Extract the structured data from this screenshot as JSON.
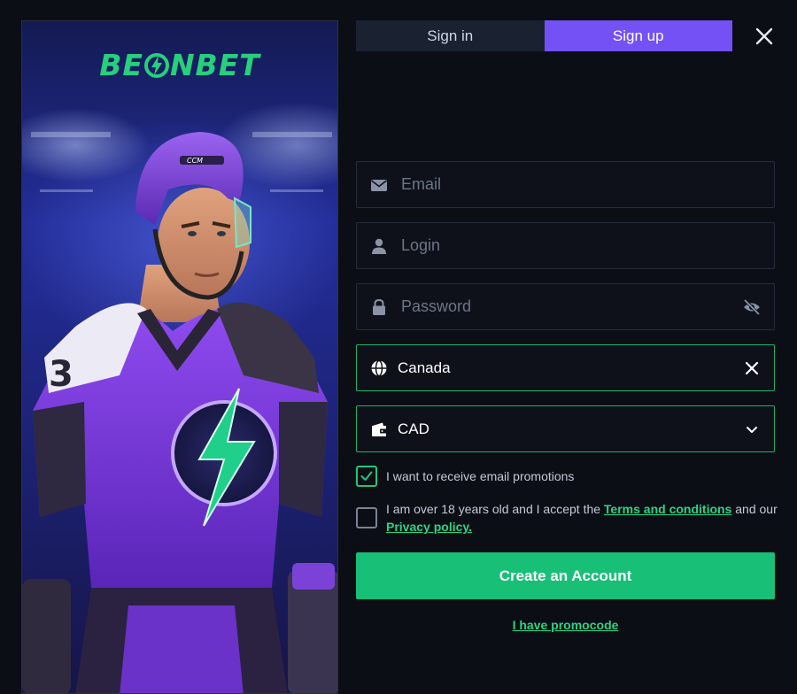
{
  "brand": {
    "logo_text": "BEONBET",
    "logo_before": "BE",
    "logo_after": "NBET"
  },
  "tabs": {
    "sign_in": "Sign in",
    "sign_up": "Sign up",
    "active": "sign_up"
  },
  "form": {
    "email": {
      "placeholder": "Email",
      "icon": "envelope-icon"
    },
    "login": {
      "placeholder": "Login",
      "icon": "user-icon"
    },
    "password": {
      "placeholder": "Password",
      "icon": "lock-icon",
      "toggle_icon": "eye-off-icon"
    },
    "country": {
      "value": "Canada",
      "icon": "globe-icon",
      "clear_icon": "close-icon"
    },
    "currency": {
      "value": "CAD",
      "icon": "wallet-icon",
      "dropdown_icon": "chevron-down-icon"
    }
  },
  "consents": {
    "email_promotions": {
      "label": "I want to receive email promotions",
      "checked": true
    },
    "terms": {
      "text_before": "I am over 18 years old and I accept the",
      "terms_link": "Terms and conditions",
      "text_middle": "and our",
      "privacy_link": "Privacy policy.",
      "checked": false
    }
  },
  "actions": {
    "create_account": "Create an Account",
    "promocode": "I have promocode"
  },
  "colors": {
    "accent_green": "#17bf77",
    "accent_purple": "#7351f5",
    "background": "#0c0e16"
  }
}
